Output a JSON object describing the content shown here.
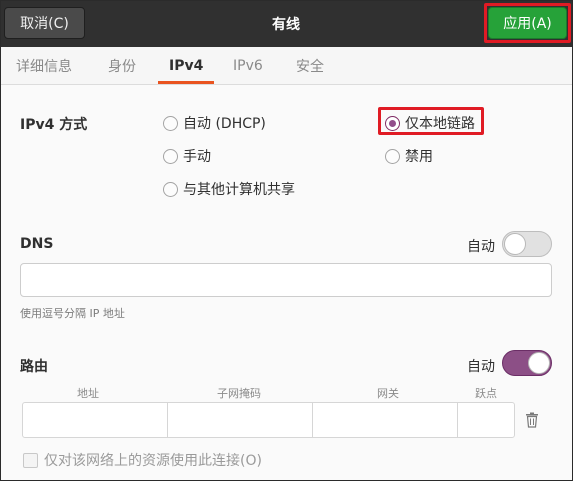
{
  "header": {
    "cancel_label": "取消(C)",
    "title": "有线",
    "apply_label": "应用(A)"
  },
  "tabs": [
    {
      "label": "详细信息"
    },
    {
      "label": "身份"
    },
    {
      "label": "IPv4",
      "active": true
    },
    {
      "label": "IPv6"
    },
    {
      "label": "安全"
    }
  ],
  "ipv4_method": {
    "label": "IPv4 方式",
    "options": [
      {
        "label": "自动 (DHCP)",
        "checked": false
      },
      {
        "label": "仅本地链路",
        "checked": true
      },
      {
        "label": "手动",
        "checked": false
      },
      {
        "label": "禁用",
        "checked": false
      },
      {
        "label": "与其他计算机共享",
        "checked": false
      }
    ]
  },
  "dns": {
    "label": "DNS",
    "auto_label": "自动",
    "auto_enabled": false,
    "value": "",
    "hint": "使用逗号分隔 IP 地址"
  },
  "routes": {
    "label": "路由",
    "auto_label": "自动",
    "auto_enabled": true,
    "columns": [
      "地址",
      "子网掩码",
      "网关",
      "跃点"
    ]
  },
  "only_local_checkbox": {
    "label": "仅对该网络上的资源使用此连接(O)",
    "checked": false
  },
  "colors": {
    "accent": "#e95420",
    "apply_green": "#26a239",
    "toggle_on": "#8c4f86",
    "highlight_red": "#e01b24"
  }
}
